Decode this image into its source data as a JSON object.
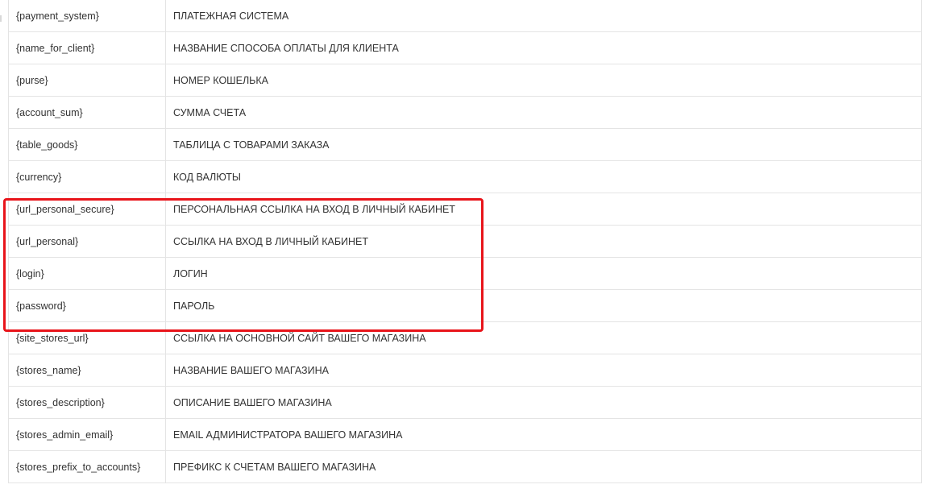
{
  "table": {
    "rows": [
      {
        "variable": "{payment_system}",
        "description": "ПЛАТЕЖНАЯ СИСТЕМА"
      },
      {
        "variable": "{name_for_client}",
        "description": "НАЗВАНИЕ СПОСОБА ОПЛАТЫ ДЛЯ КЛИЕНТА"
      },
      {
        "variable": "{purse}",
        "description": "НОМЕР КОШЕЛЬКА"
      },
      {
        "variable": "{account_sum}",
        "description": "СУММА СЧЕТА"
      },
      {
        "variable": "{table_goods}",
        "description": "ТАБЛИЦА С ТОВАРАМИ ЗАКАЗА"
      },
      {
        "variable": "{currency}",
        "description": "КОД ВАЛЮТЫ"
      },
      {
        "variable": "{url_personal_secure}",
        "description": "ПЕРСОНАЛЬНАЯ ССЫЛКА НА ВХОД В ЛИЧНЫЙ КАБИНЕТ"
      },
      {
        "variable": "{url_personal}",
        "description": "ССЫЛКА НА ВХОД В ЛИЧНЫЙ КАБИНЕТ"
      },
      {
        "variable": "{login}",
        "description": "ЛОГИН"
      },
      {
        "variable": "{password}",
        "description": "ПАРОЛЬ"
      },
      {
        "variable": "{site_stores_url}",
        "description": "ССЫЛКА НА ОСНОВНОЙ САЙТ ВАШЕГО МАГАЗИНА"
      },
      {
        "variable": "{stores_name}",
        "description": "НАЗВАНИЕ ВАШЕГО МАГАЗИНА"
      },
      {
        "variable": "{stores_description}",
        "description": "ОПИСАНИЕ ВАШЕГО МАГАЗИНА"
      },
      {
        "variable": "{stores_admin_email}",
        "description": "EMAIL АДМИНИСТРАТОРА ВАШЕГО МАГАЗИНА"
      },
      {
        "variable": "{stores_prefix_to_accounts}",
        "description": "ПРЕФИКС К СЧЕТАМ ВАШЕГО МАГАЗИНА"
      }
    ]
  },
  "highlight": {
    "color": "#e8141a",
    "covers_rows": [
      "{url_personal_secure}",
      "{url_personal}",
      "{login}",
      "{password}"
    ]
  }
}
